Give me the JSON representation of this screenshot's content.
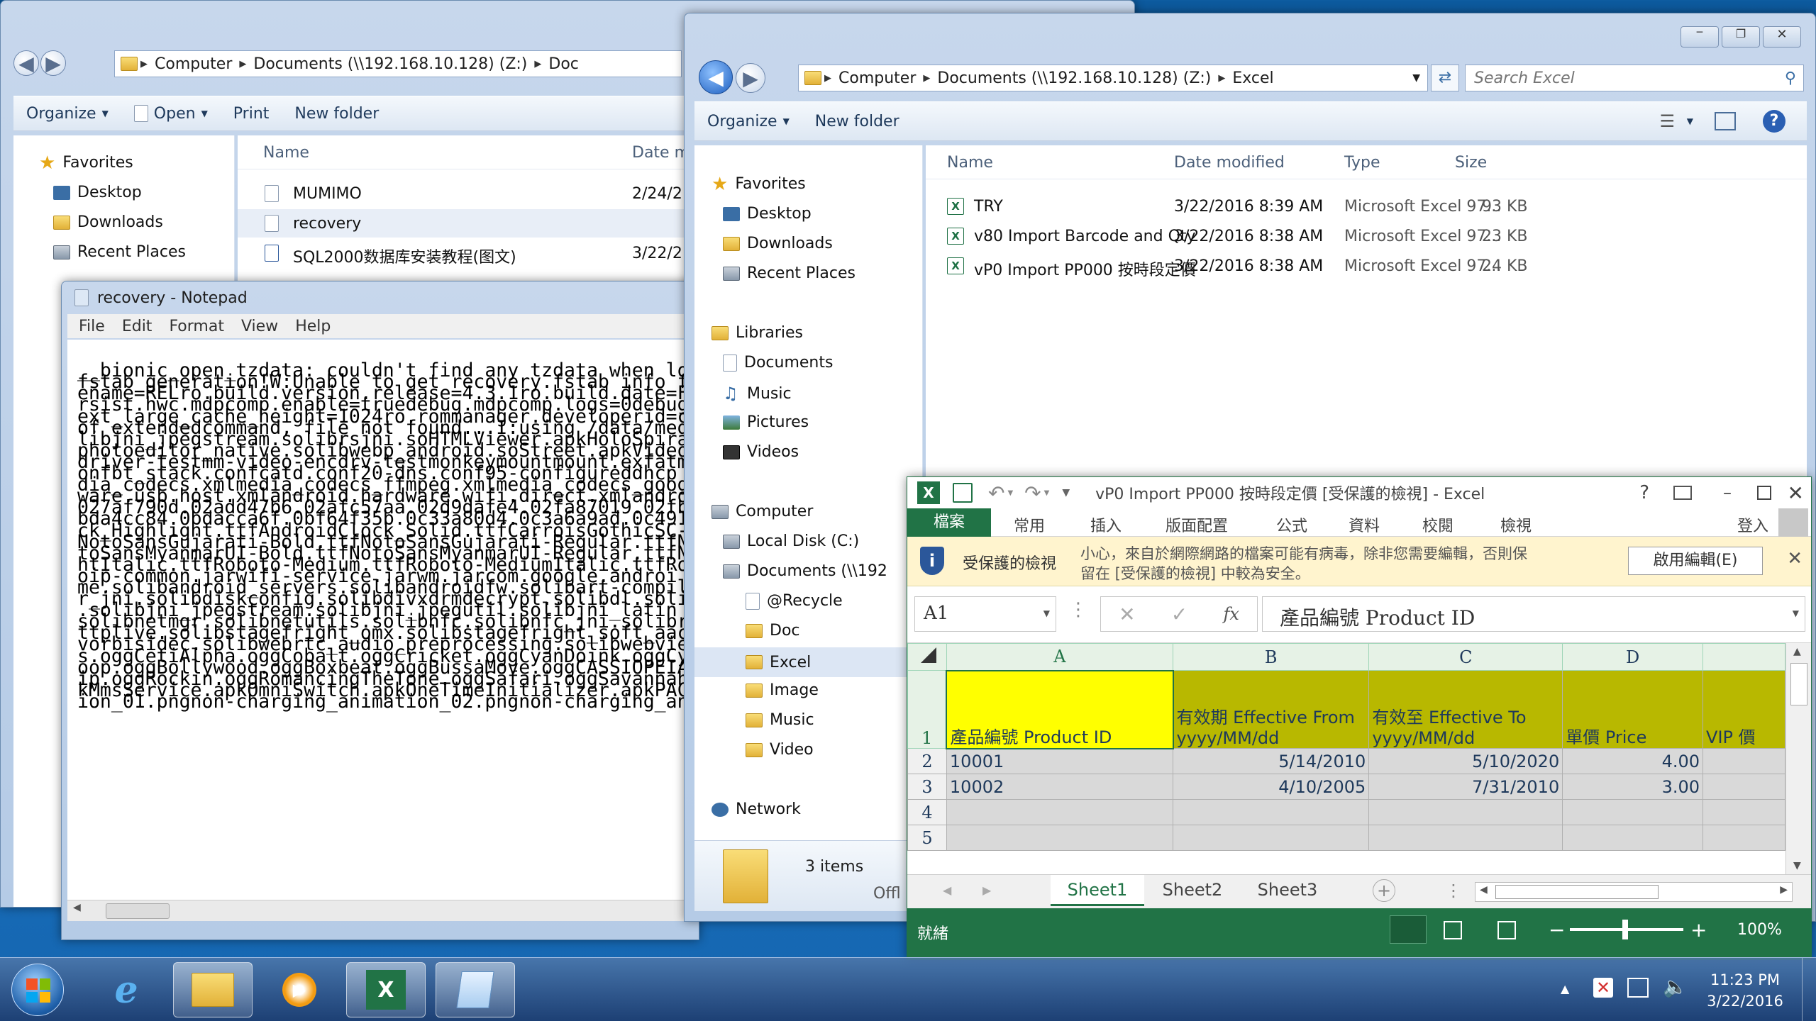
{
  "explorer_doc": {
    "address": [
      "Computer",
      "Documents (\\\\192.168.10.128) (Z:)",
      "Doc"
    ],
    "commands": {
      "organize": "Organize",
      "open": "Open",
      "print": "Print",
      "new_folder": "New folder"
    },
    "nav": {
      "favorites": "Favorites",
      "desktop": "Desktop",
      "downloads": "Downloads",
      "recent": "Recent Places"
    },
    "columns": {
      "name": "Name",
      "date": "Date m"
    },
    "files": [
      {
        "name": "MUMIMO",
        "date": "2/24/2"
      },
      {
        "name": "recovery",
        "date": ""
      },
      {
        "name": "SQL2000数据库安装教程(图文)",
        "date": "3/22/2"
      }
    ]
  },
  "notepad": {
    "title": "recovery - Notepad",
    "menu": [
      "File",
      "Edit",
      "Format",
      "View",
      "Help"
    ],
    "lines": [
      "__bionic_open_tzdata: couldn't find any tzdata when lo",
      "fstab generation!W:Unable to get recovery.fstab info f",
      "ename=RELro.build.version.release=4.3.1ro.build.date=F",
      "rsist.hwc.mdpcomp.enable=truedebug.mdpcomp.logs=0debug",
      "ext_large_cache_height=1024ro.rommanager.developerid=c",
      "of extendedcommand, file not found...I:using /data/med",
      "libjni_jpegstream.solibrsjni.soHTMLViewer.apkHoloSpira",
      "photoeditor_native.solibwebp_android.soStreet.apkVideo",
      "driver-testmm-video-encdrv-testmonkeymountmount.exfatm",
      "onfbt_stack.confcatd.conf20-dns.conf95-configureddhcp",
      "dia_codecs.xmlmedia_codecs_ffmpeg.xmlmedia_codecs_goog",
      "ware.usb.host.xmlandroid.hardware.wifi.direct.xmlandro",
      "027af790d.02add47b6.02afc57aa.02d9dafe4.02fa87019.02fb",
      "bda4cc84.0bdacca6f.0bf64f35b.0c33a80d4.0c3a6a9ad.0c491",
      "ck_Highlight.ttfAndroidClock_Solid.ttfCarroisGothicSC-",
      "NotoSansGujarati-Bold.ttfNotoSansGujarati-Regular.ttfN",
      "toSansMyanmarUI-Bold.ttfNotoSansMyanmarUI-Regular.ttfN",
      "htItalic.ttfRoboto-Medium.ttfRoboto-MediumItalic.ttfRo",
      "oip-common.jarwifi-service.jarwm.jarcom.google.androi",
      "me.solibandroid_servers.solibandroidfw.solibart-compil",
      "r_jni.solibdiskconfig.solibdivxdrmdecrypt.solibdl.soli",
      ".solibjni_jpegstream.solibjni_jpegutil.solibjni_latin",
      "solibnetmgr.solibnetutils.solibnfc.solibnfc_jni.solibr",
      "ttplive.solibstagefright_omx.solibstagefright_soft_aac",
      "vorbisidec.solibwebrtc_audio_preprocessing.solibwebvie",
      "s.oggCetiAlpha.oggCobalt.oggCricket.oggCyanDoink.oggCy",
      "oop.oggBollywood.oggBoxbeat.oggBussaMove.oggCASSIOPEIA",
      "ip.oggRockin.oggRomancingTheTone.oggSafari.oggSavannah",
      "kMmsService.apkOmniSwitch.apkOneTimeInitializer.apkPAC",
      "ion_01.pngnon-charging_animation_02.pngnon-charging_an"
    ]
  },
  "explorer_excel": {
    "address": [
      "Computer",
      "Documents (\\\\192.168.10.128) (Z:)",
      "Excel"
    ],
    "search_placeholder": "Search Excel",
    "commands": {
      "organize": "Organize",
      "new_folder": "New folder"
    },
    "nav": {
      "favorites": "Favorites",
      "desktop": "Desktop",
      "downloads": "Downloads",
      "recent": "Recent Places",
      "libraries": "Libraries",
      "documents": "Documents",
      "music": "Music",
      "pictures": "Pictures",
      "videos": "Videos",
      "computer": "Computer",
      "local_disk": "Local Disk (C:)",
      "net_docs": "Documents (\\\\192",
      "recycle": "@Recycle",
      "doc": "Doc",
      "excel": "Excel",
      "image": "Image",
      "music2": "Music",
      "video": "Video",
      "network": "Network"
    },
    "columns": {
      "name": "Name",
      "date": "Date modified",
      "type": "Type",
      "size": "Size"
    },
    "files": [
      {
        "name": "TRY",
        "date": "3/22/2016 8:39 AM",
        "type": "Microsoft Excel 97...",
        "size": "93 KB"
      },
      {
        "name": "v80 Import Barcode and Qty",
        "date": "3/22/2016 8:38 AM",
        "type": "Microsoft Excel 97...",
        "size": "23 KB"
      },
      {
        "name": "vP0 Import PP000 按時段定價",
        "date": "3/22/2016 8:38 AM",
        "type": "Microsoft Excel 97...",
        "size": "24 KB"
      }
    ],
    "status_count": "3 items",
    "status_extra": "Offl"
  },
  "excel": {
    "title": "vP0 Import PP000 按時段定價 [受保護的檢視] - Excel",
    "help": "?",
    "tabs": [
      "檔案",
      "常用",
      "插入",
      "版面配置",
      "公式",
      "資料",
      "校閱",
      "檢視"
    ],
    "signin": "登入",
    "pv_title": "受保護的檢視",
    "pv_message_1": "小心，來自於網際網路的檔案可能有病毒，除非您需要編輯，否則保",
    "pv_message_2": "留在 [受保護的檢視] 中較為安全。",
    "pv_button": "啟用編輯(E)",
    "name_box": "A1",
    "formula": "產品編號 Product ID",
    "fx": "fx",
    "columns": [
      "A",
      "B",
      "C",
      "D"
    ],
    "rows": [
      "1",
      "2",
      "3",
      "4",
      "5"
    ],
    "header_row": {
      "a": "產品編號 Product ID",
      "b1": "有效期 Effective From",
      "b2": "yyyy/MM/dd",
      "c1": "有效至 Effective To",
      "c2": "yyyy/MM/dd",
      "d": "單價 Price",
      "e": "VIP 價"
    },
    "data_rows": [
      {
        "a": "10001",
        "b": "5/14/2010",
        "c": "5/10/2020",
        "d": "4.00"
      },
      {
        "a": "10002",
        "b": "4/10/2005",
        "c": "7/31/2010",
        "d": "3.00"
      }
    ],
    "sheets": [
      "Sheet1",
      "Sheet2",
      "Sheet3"
    ],
    "status": "就緒",
    "zoom": "100%",
    "zoom_minus": "−",
    "zoom_plus": "+"
  },
  "taskbar": {
    "time": "11:23 PM",
    "date": "3/22/2016"
  },
  "colors": {
    "xl_green": "#217346",
    "header_yellow": "#ffff00",
    "row_olive": "#b8b800",
    "warning_bar": "#fff4ce"
  }
}
